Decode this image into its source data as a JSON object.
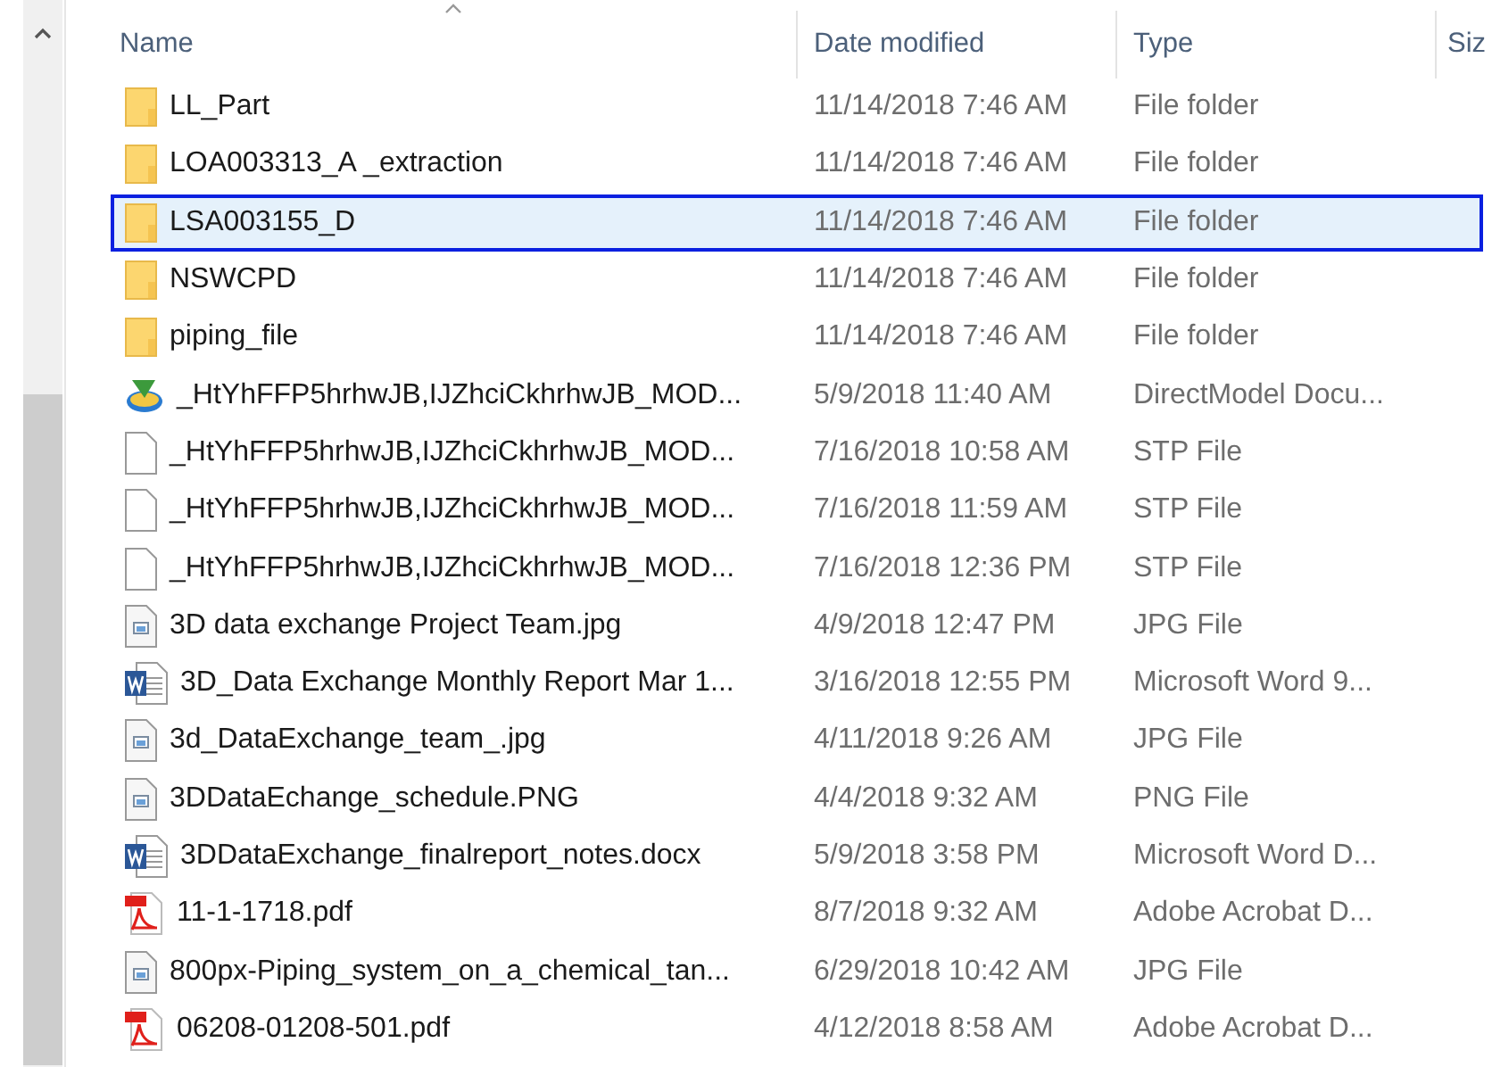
{
  "columns": [
    {
      "label": "Name",
      "sorted": true
    },
    {
      "label": "Date modified",
      "sorted": false
    },
    {
      "label": "Type",
      "sorted": false
    },
    {
      "label": "Siz",
      "sorted": false
    }
  ],
  "rows": [
    {
      "kind": "folder",
      "name": "LL_Part",
      "date": "11/14/2018 7:46 AM",
      "type": "File folder",
      "selected": false
    },
    {
      "kind": "folder",
      "name": "LOA003313_A _extraction",
      "date": "11/14/2018 7:46 AM",
      "type": "File folder",
      "selected": false
    },
    {
      "kind": "folder",
      "name": "LSA003155_D",
      "date": "11/14/2018 7:46 AM",
      "type": "File folder",
      "selected": true
    },
    {
      "kind": "folder",
      "name": "NSWCPD",
      "date": "11/14/2018 7:46 AM",
      "type": "File folder",
      "selected": false
    },
    {
      "kind": "folder",
      "name": "piping_file",
      "date": "11/14/2018 7:46 AM",
      "type": "File folder",
      "selected": false
    },
    {
      "kind": "model",
      "name": "_HtYhFFP5hrhwJB,IJZhciCkhrhwJB_MOD...",
      "date": "5/9/2018 11:40 AM",
      "type": "DirectModel Docu...",
      "selected": false
    },
    {
      "kind": "blank",
      "name": "_HtYhFFP5hrhwJB,IJZhciCkhrhwJB_MOD...",
      "date": "7/16/2018 10:58 AM",
      "type": "STP File",
      "selected": false
    },
    {
      "kind": "blank",
      "name": "_HtYhFFP5hrhwJB,IJZhciCkhrhwJB_MOD...",
      "date": "7/16/2018 11:59 AM",
      "type": "STP File",
      "selected": false
    },
    {
      "kind": "blank",
      "name": "_HtYhFFP5hrhwJB,IJZhciCkhrhwJB_MOD...",
      "date": "7/16/2018 12:36 PM",
      "type": "STP File",
      "selected": false
    },
    {
      "kind": "image",
      "name": "3D data exchange Project Team.jpg",
      "date": "4/9/2018 12:47 PM",
      "type": "JPG File",
      "selected": false
    },
    {
      "kind": "word",
      "name": "3D_Data Exchange Monthly Report Mar 1...",
      "date": "3/16/2018 12:55 PM",
      "type": "Microsoft Word 9...",
      "selected": false
    },
    {
      "kind": "image",
      "name": "3d_DataExchange_team_.jpg",
      "date": "4/11/2018 9:26 AM",
      "type": "JPG File",
      "selected": false
    },
    {
      "kind": "image",
      "name": "3DDataEchange_schedule.PNG",
      "date": "4/4/2018 9:32 AM",
      "type": "PNG File",
      "selected": false
    },
    {
      "kind": "word",
      "name": "3DDataExchange_finalreport_notes.docx",
      "date": "5/9/2018 3:58 PM",
      "type": "Microsoft Word D...",
      "selected": false
    },
    {
      "kind": "pdf",
      "name": "11-1-1718.pdf",
      "date": "8/7/2018 9:32 AM",
      "type": "Adobe Acrobat D...",
      "selected": false
    },
    {
      "kind": "image",
      "name": "800px-Piping_system_on_a_chemical_tan...",
      "date": "6/29/2018 10:42 AM",
      "type": "JPG File",
      "selected": false
    },
    {
      "kind": "pdf",
      "name": "06208-01208-501.pdf",
      "date": "4/12/2018 8:58 AM",
      "type": "Adobe Acrobat D...",
      "selected": false
    }
  ]
}
